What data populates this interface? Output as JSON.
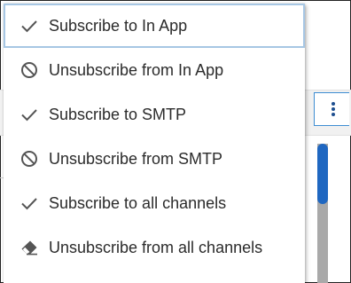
{
  "menu": {
    "items": [
      {
        "label": "Subscribe to In App",
        "icon": "check-icon"
      },
      {
        "label": "Unsubscribe from In App",
        "icon": "block-icon"
      },
      {
        "label": "Subscribe to SMTP",
        "icon": "check-icon"
      },
      {
        "label": "Unsubscribe from SMTP",
        "icon": "block-icon"
      },
      {
        "label": "Subscribe to all channels",
        "icon": "check-icon"
      },
      {
        "label": "Unsubscribe from all channels",
        "icon": "eraser-icon"
      }
    ],
    "focused_index": 0
  },
  "colors": {
    "focus_border": "#a7c7e4",
    "icon": "#555555",
    "text": "#2b2b2b",
    "scroll_thumb": "#1f67c1",
    "kebab": "#1d4e8f"
  }
}
